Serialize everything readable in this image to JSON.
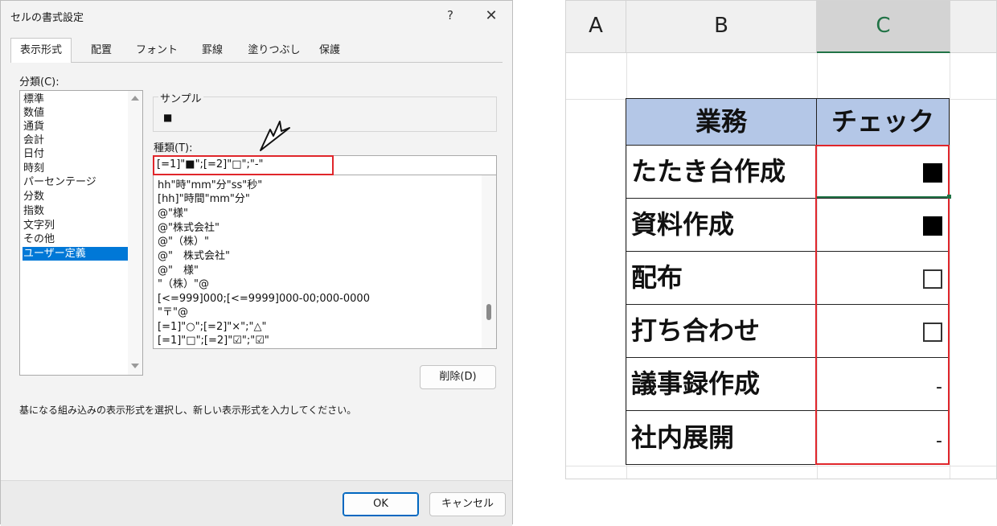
{
  "dialog": {
    "title": "セルの書式設定",
    "help": "?",
    "close": "✕",
    "tabs": [
      "表示形式",
      "配置",
      "フォント",
      "罫線",
      "塗りつぶし",
      "保護"
    ],
    "category_label": "分類(C):",
    "categories": [
      "標準",
      "数値",
      "通貨",
      "会計",
      "日付",
      "時刻",
      "パーセンテージ",
      "分数",
      "指数",
      "文字列",
      "その他",
      "ユーザー定義"
    ],
    "selected_category": "ユーザー定義",
    "sample_label": "サンプル",
    "sample_value": "■",
    "type_label": "種類(T):",
    "format_input": "[=1]\"■\";[=2]\"□\";\"-\"",
    "format_list": [
      "hh\"時\"mm\"分\"ss\"秒\"",
      "[hh]\"時間\"mm\"分\"",
      "@\"様\"",
      "@\"株式会社\"",
      "@\"（株）\"",
      "@\"　株式会社\"",
      "@\"　様\"",
      "\"（株）\"@",
      "[<=999]000;[<=9999]000-00;000-0000",
      "\"〒\"@",
      "[=1]\"○\";[=2]\"×\";\"△\"",
      "[=1]\"□\";[=2]\"☑\";\"☑\""
    ],
    "delete_button": "削除(D)",
    "description": "基になる組み込みの表示形式を選択し、新しい表示形式を入力してください。",
    "ok_button": "OK",
    "cancel_button": "キャンセル"
  },
  "sheet": {
    "columns": [
      "A",
      "B",
      "C"
    ],
    "active_column": "C",
    "header_task": "業務",
    "header_check": "チェック",
    "rows": [
      {
        "task": "たたき台作成",
        "check": "■"
      },
      {
        "task": "資料作成",
        "check": "■"
      },
      {
        "task": "配布",
        "check": "□"
      },
      {
        "task": "打ち合わせ",
        "check": "□"
      },
      {
        "task": "議事録作成",
        "check": "-"
      },
      {
        "task": "社内展開",
        "check": "-"
      }
    ],
    "colors": {
      "header_fill": "#b4c7e7",
      "highlight": "#e0262b",
      "selection": "#217346"
    }
  }
}
